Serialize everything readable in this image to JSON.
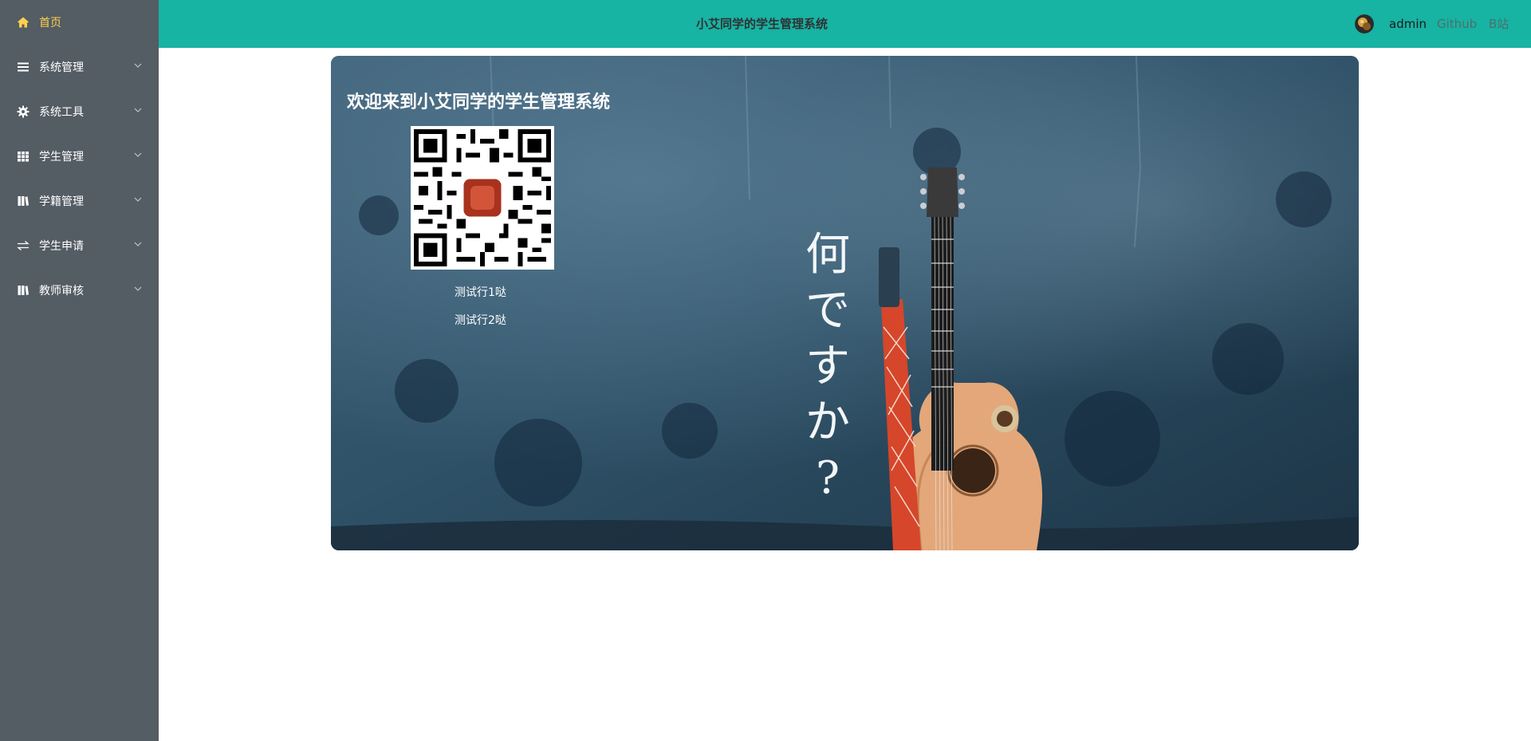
{
  "sidebar": {
    "items": [
      {
        "label": "首页",
        "icon": "home-icon",
        "active": true
      },
      {
        "label": "系统管理",
        "icon": "menu-icon"
      },
      {
        "label": "系统工具",
        "icon": "gear-icon"
      },
      {
        "label": "学生管理",
        "icon": "grid-icon"
      },
      {
        "label": "学籍管理",
        "icon": "books-icon"
      },
      {
        "label": "学生申请",
        "icon": "swap-icon"
      },
      {
        "label": "教师审核",
        "icon": "books-icon"
      }
    ],
    "colors": {
      "background": "#545c64",
      "text": "#ffffff",
      "active": "#ffd04b"
    }
  },
  "header": {
    "title": "小艾同学的学生管理系统",
    "user": "admin",
    "links": [
      "Github",
      "B站"
    ],
    "background": "#17b3a3"
  },
  "banner": {
    "welcome": "欢迎来到小艾同学的学生管理系统",
    "line1": "测试行1哒",
    "line2": "测试行2哒",
    "jp_chars": [
      "何",
      "で",
      "す",
      "か",
      "?"
    ]
  }
}
